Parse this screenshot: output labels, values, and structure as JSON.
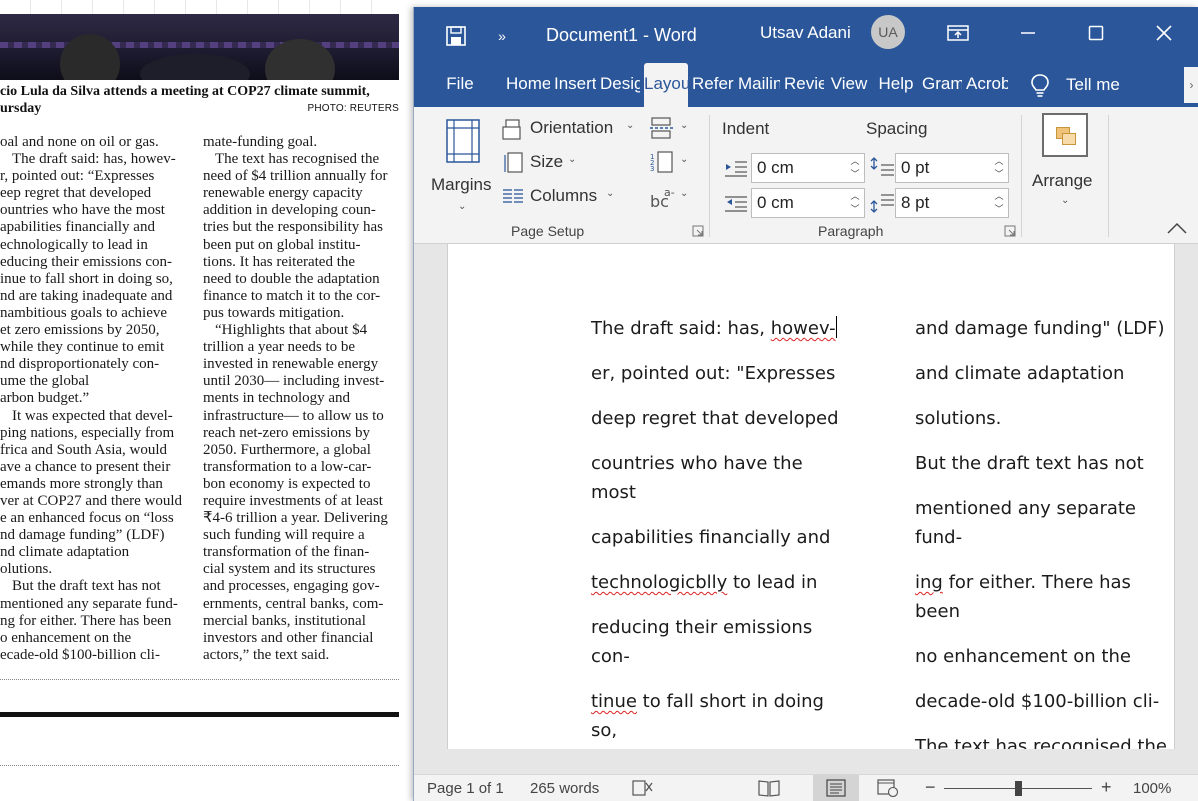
{
  "newspaper": {
    "caption_line1": "cio Lula da Silva attends a meeting at COP27 climate summit,",
    "caption_line2": "ursday",
    "photo_credit": "PHOTO: REUTERS",
    "col1": [
      {
        "t": "oal and none on oil or gas.",
        "i": false
      },
      {
        "t": "The draft said: has, howev-",
        "i": true
      },
      {
        "t": "r, pointed out: “Expresses",
        "i": false
      },
      {
        "t": "eep regret that developed",
        "i": false
      },
      {
        "t": "ountries who have the most",
        "i": false
      },
      {
        "t": "apabilities financially and",
        "i": false
      },
      {
        "t": "echnologically to lead in",
        "i": false
      },
      {
        "t": "educing their emissions con-",
        "i": false
      },
      {
        "t": "inue to fall short in doing so,",
        "i": false
      },
      {
        "t": "nd are taking inadequate and",
        "i": false
      },
      {
        "t": "nambitious goals to achieve",
        "i": false
      },
      {
        "t": "et zero emissions by 2050,",
        "i": false
      },
      {
        "t": "while they continue to emit",
        "i": false
      },
      {
        "t": "nd disproportionately con-",
        "i": false
      },
      {
        "t": "ume     the     global",
        "i": false
      },
      {
        "t": "arbon budget.”",
        "i": false
      },
      {
        "t": "It was expected that devel-",
        "i": true
      },
      {
        "t": "ping nations, especially from",
        "i": false
      },
      {
        "t": "frica and South Asia, would",
        "i": false
      },
      {
        "t": "ave a chance to present their",
        "i": false
      },
      {
        "t": "emands more strongly than",
        "i": false
      },
      {
        "t": "ver at COP27 and there would",
        "i": false
      },
      {
        "t": "e an enhanced focus on “loss",
        "i": false
      },
      {
        "t": "nd damage funding” (LDF)",
        "i": false
      },
      {
        "t": "nd    climate    adaptation",
        "i": false
      },
      {
        "t": "olutions.",
        "i": false
      },
      {
        "t": "But the draft text has not",
        "i": true
      },
      {
        "t": "mentioned any separate fund-",
        "i": false
      },
      {
        "t": "ng for either. There has been",
        "i": false
      },
      {
        "t": "o  enhancement  on  the",
        "i": false
      },
      {
        "t": "ecade-old $100-billion cli-",
        "i": false
      }
    ],
    "col2": [
      {
        "t": "mate-funding goal.",
        "i": false
      },
      {
        "t": "The text has recognised the",
        "i": true
      },
      {
        "t": "need of $4 trillion annually for",
        "i": false
      },
      {
        "t": "renewable energy capacity",
        "i": false
      },
      {
        "t": "addition in developing coun-",
        "i": false
      },
      {
        "t": "tries but the responsibility has",
        "i": false
      },
      {
        "t": "been put on global institu-",
        "i": false
      },
      {
        "t": "tions. It has reiterated the",
        "i": false
      },
      {
        "t": "need to double the adaptation",
        "i": false
      },
      {
        "t": "finance to match it to the cor-",
        "i": false
      },
      {
        "t": "pus towards mitigation.",
        "i": false
      },
      {
        "t": "“Highlights that about $4",
        "i": true
      },
      {
        "t": "trillion a year needs to be",
        "i": false
      },
      {
        "t": "invested in renewable energy",
        "i": false
      },
      {
        "t": "until 2030— including invest-",
        "i": false
      },
      {
        "t": "ments in technology and",
        "i": false
      },
      {
        "t": "infrastructure— to allow us to",
        "i": false
      },
      {
        "t": "reach net-zero emissions by",
        "i": false
      },
      {
        "t": "2050. Furthermore, a global",
        "i": false
      },
      {
        "t": "transformation to a low-car-",
        "i": false
      },
      {
        "t": "bon economy is expected to",
        "i": false
      },
      {
        "t": "require investments of at least",
        "i": false
      },
      {
        "t": "₹4-6 trillion a year. Delivering",
        "i": false
      },
      {
        "t": "such funding will require a",
        "i": false
      },
      {
        "t": "transformation of the finan-",
        "i": false
      },
      {
        "t": "cial system and its structures",
        "i": false
      },
      {
        "t": "and processes, engaging gov-",
        "i": false
      },
      {
        "t": "ernments, central banks, com-",
        "i": false
      },
      {
        "t": "mercial banks, institutional",
        "i": false
      },
      {
        "t": "investors and other financial",
        "i": false
      },
      {
        "t": "actors,” the text said.",
        "i": false
      }
    ]
  },
  "word": {
    "title": "Document1  -  Word",
    "user_name": "Utsav Adani",
    "user_initials": "UA",
    "colors": {
      "accent": "#2b579a",
      "ribbon_bg": "#f3f3f3"
    },
    "tabs": [
      {
        "label": "File",
        "active": false
      },
      {
        "label": "Home",
        "active": false
      },
      {
        "label": "Insert",
        "active": false
      },
      {
        "label": "Design",
        "active": false
      },
      {
        "label": "Layout",
        "active": true
      },
      {
        "label": "References",
        "active": false
      },
      {
        "label": "Mailings",
        "active": false
      },
      {
        "label": "Review",
        "active": false
      },
      {
        "label": "View",
        "active": false
      },
      {
        "label": "Help",
        "active": false
      },
      {
        "label": "Grammarly",
        "active": false
      },
      {
        "label": "Acrobat",
        "active": false
      }
    ],
    "tell_me": "Tell me",
    "ribbon": {
      "margins": "Margins",
      "orientation": "Orientation",
      "size": "Size",
      "columns": "Columns",
      "page_setup_group": "Page Setup",
      "indent_label": "Indent",
      "spacing_label": "Spacing",
      "indent_left": "0 cm",
      "indent_right": "0 cm",
      "spacing_before": "0 pt",
      "spacing_after": "8 pt",
      "paragraph_group": "Paragraph",
      "arrange": "Arrange"
    },
    "document": {
      "col1": [
        {
          "parts": [
            {
              "t": "The draft said: has, "
            },
            {
              "t": "howev-",
              "sq": true
            }
          ],
          "cursor": true
        },
        {
          "parts": [
            {
              "t": "er, pointed out: \"Expresses"
            }
          ]
        },
        {
          "parts": [
            {
              "t": "deep regret that developed"
            }
          ]
        },
        {
          "parts": [
            {
              "t": "countries who have the most"
            }
          ]
        },
        {
          "parts": [
            {
              "t": "capabilities financially and"
            }
          ]
        },
        {
          "parts": [
            {
              "t": "technologicblly",
              "sq": true
            },
            {
              "t": " to lead in"
            }
          ]
        },
        {
          "parts": [
            {
              "t": "reducing their emissions con-"
            }
          ]
        },
        {
          "parts": [
            {
              "t": "tinue",
              "sq": true
            },
            {
              "t": " to fall short in doing so,"
            }
          ]
        }
      ],
      "col2": [
        {
          "parts": [
            {
              "t": "and damage funding\" (LDF)"
            }
          ]
        },
        {
          "parts": [
            {
              "t": "and climate adaptation"
            }
          ]
        },
        {
          "parts": [
            {
              "t": "solutions."
            }
          ]
        },
        {
          "parts": [
            {
              "t": "But the draft text has not"
            }
          ]
        },
        {
          "parts": [
            {
              "t": "mentioned any separate fund-"
            }
          ]
        },
        {
          "parts": [
            {
              "t": "ing",
              "sq": true
            },
            {
              "t": " for either. There has been"
            }
          ]
        },
        {
          "parts": [
            {
              "t": "no enhancement on the"
            }
          ]
        },
        {
          "parts": [
            {
              "t": "decade-old $100-billion cli-"
            }
          ]
        },
        {
          "parts": [
            {
              "t": "The text has recognised the"
            }
          ]
        }
      ]
    },
    "status": {
      "page": "Page 1 of 1",
      "words": "265 words",
      "zoom_level": "100%",
      "zoom_fraction": 0.5
    }
  }
}
